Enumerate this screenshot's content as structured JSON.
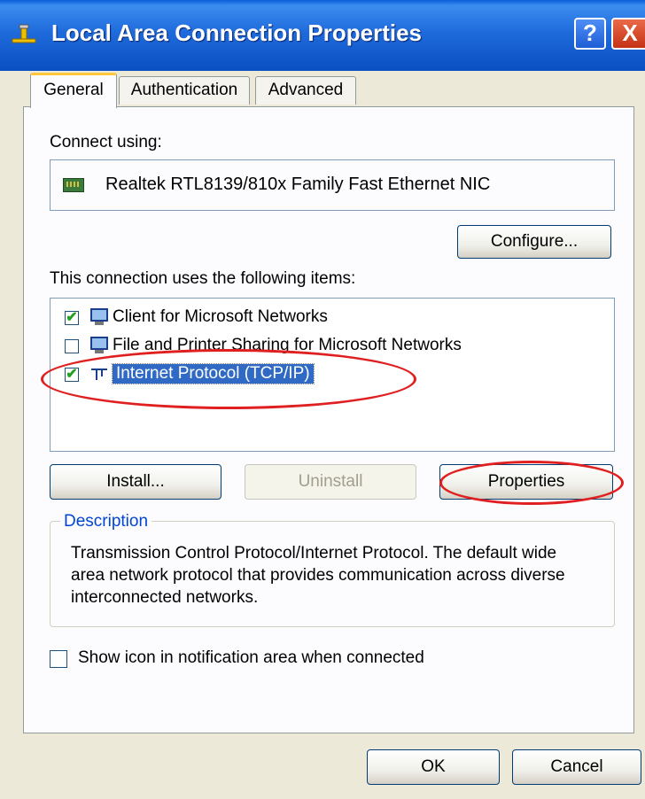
{
  "window": {
    "title": "Local Area Connection Properties",
    "help_label": "?",
    "close_label": "X"
  },
  "tabs": [
    {
      "label": "General",
      "active": true
    },
    {
      "label": "Authentication",
      "active": false
    },
    {
      "label": "Advanced",
      "active": false
    }
  ],
  "connect_using": {
    "label": "Connect using:",
    "adapter": "Realtek RTL8139/810x Family Fast Ethernet NIC",
    "configure_label": "Configure..."
  },
  "items_section": {
    "label": "This connection uses the following items:",
    "items": [
      {
        "label": "Client for Microsoft Networks",
        "checked": true,
        "selected": false,
        "icon": "network-client-icon"
      },
      {
        "label": "File and Printer Sharing for Microsoft Networks",
        "checked": false,
        "selected": false,
        "icon": "file-printer-sharing-icon"
      },
      {
        "label": "Internet Protocol (TCP/IP)",
        "checked": true,
        "selected": true,
        "icon": "network-protocol-icon"
      }
    ]
  },
  "buttons": {
    "install": "Install...",
    "uninstall": "Uninstall",
    "properties": "Properties"
  },
  "description": {
    "title": "Description",
    "text": "Transmission Control Protocol/Internet Protocol. The default wide area network protocol that provides communication across diverse interconnected networks."
  },
  "notification_option": {
    "label": "Show icon in notification area when connected",
    "checked": false
  },
  "footer": {
    "ok": "OK",
    "cancel": "Cancel"
  },
  "colors": {
    "titlebar": "#0A5FD8",
    "selection": "#316AC5",
    "highlight_circle": "#E02020",
    "description_title": "#0046D5"
  }
}
